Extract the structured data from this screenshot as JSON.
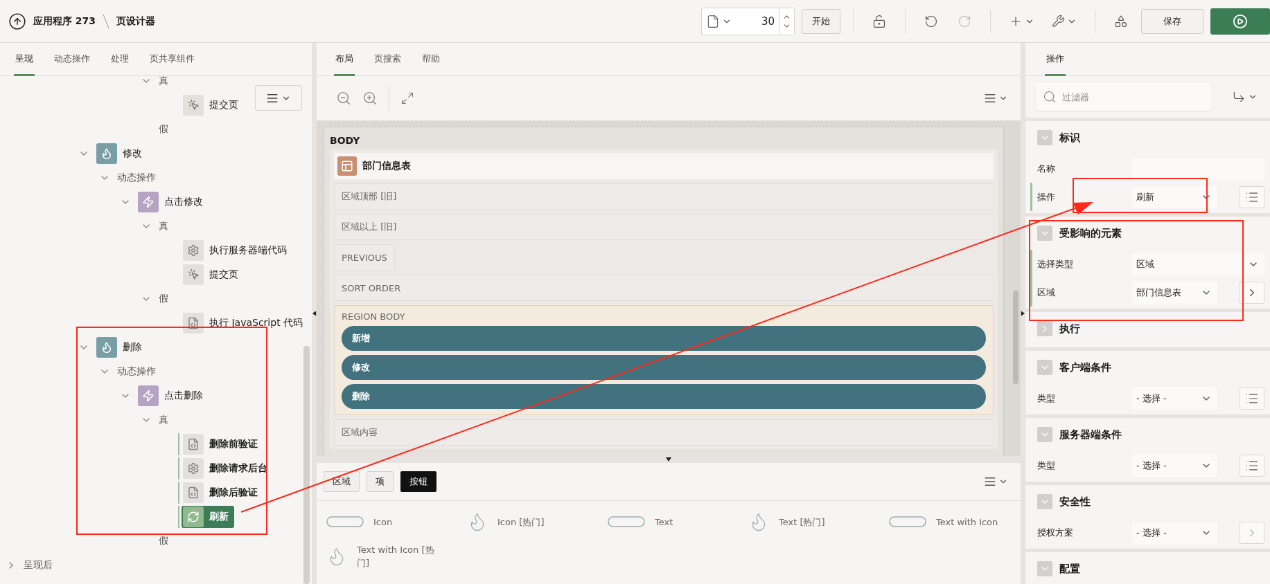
{
  "header": {
    "app": "应用程序 273",
    "page_title": "页设计器",
    "page_number": "30",
    "go_label": "开始",
    "redo": {
      "disabled": true
    },
    "save_label": "保存"
  },
  "left_tabs": [
    {
      "label": "呈现",
      "selected": true
    },
    {
      "label": "动态操作",
      "selected": false
    },
    {
      "label": "处理",
      "selected": false
    },
    {
      "label": "页共享组件",
      "selected": false
    }
  ],
  "tree": {
    "partial": [
      {
        "label": "真",
        "kind": "folder",
        "expanded": true,
        "selected": false,
        "children": [
          {
            "label": "提交页",
            "kind": "submit",
            "selected": false,
            "marked": false
          }
        ]
      },
      {
        "label": "假",
        "kind": "folder",
        "selected": false
      }
    ],
    "branches": [
      {
        "label": "修改",
        "kind": "button",
        "expanded": true,
        "selected": false,
        "children": [
          {
            "label": "动态操作",
            "kind": "folder",
            "expanded": true,
            "selected": false,
            "children": [
              {
                "label": "点击修改",
                "kind": "event",
                "expanded": true,
                "selected": false,
                "children": [
                  {
                    "label": "真",
                    "kind": "folder",
                    "expanded": true,
                    "selected": false,
                    "children": [
                      {
                        "label": "执行服务器端代码",
                        "kind": "server",
                        "selected": false,
                        "marked": false
                      },
                      {
                        "label": "提交页",
                        "kind": "submit",
                        "selected": false,
                        "marked": false
                      }
                    ]
                  },
                  {
                    "label": "假",
                    "kind": "folder",
                    "expanded": true,
                    "selected": false,
                    "children": [
                      {
                        "label": "执行 JavaScript 代码",
                        "kind": "js",
                        "selected": false,
                        "marked": false
                      }
                    ]
                  }
                ]
              }
            ]
          }
        ]
      },
      {
        "label": "删除",
        "kind": "button",
        "expanded": true,
        "selected": false,
        "children": [
          {
            "label": "动态操作",
            "kind": "folder",
            "expanded": true,
            "selected": false,
            "children": [
              {
                "label": "点击删除",
                "kind": "event",
                "expanded": true,
                "selected": false,
                "children": [
                  {
                    "label": "真",
                    "kind": "folder",
                    "expanded": true,
                    "selected": false,
                    "children": [
                      {
                        "label": "删除前验证",
                        "kind": "js",
                        "selected": false,
                        "marked": true
                      },
                      {
                        "label": "删除请求后台",
                        "kind": "server",
                        "selected": false,
                        "marked": true
                      },
                      {
                        "label": "删除后验证",
                        "kind": "js",
                        "selected": false,
                        "marked": true
                      },
                      {
                        "label": "刷新",
                        "kind": "refresh",
                        "selected": true,
                        "marked": true
                      }
                    ]
                  },
                  {
                    "label": "假",
                    "kind": "folder",
                    "selected": false
                  }
                ]
              }
            ]
          }
        ]
      }
    ],
    "after": [
      {
        "label": "呈现后",
        "kind": "folder",
        "expanded": false,
        "selected": false
      }
    ]
  },
  "center_tabs": [
    {
      "label": "布局",
      "selected": true
    },
    {
      "label": "页搜索",
      "selected": false
    },
    {
      "label": "帮助",
      "selected": false
    }
  ],
  "canvas": {
    "container": "BODY",
    "region": "部门信息表",
    "slots": [
      {
        "label": "区域顶部 [旧]",
        "kind": "slot"
      },
      {
        "label": "区域以上 [旧]",
        "kind": "slot"
      },
      {
        "label": "PREVIOUS",
        "kind": "compact"
      },
      {
        "label": "SORT ORDER",
        "kind": "slot"
      },
      {
        "label": "REGION BODY",
        "kind": "body",
        "buttons": [
          "新增",
          "修改",
          "删除"
        ]
      },
      {
        "label": "区域内容",
        "kind": "slot"
      }
    ]
  },
  "palette": {
    "tabs": [
      {
        "label": "区域",
        "selected": false
      },
      {
        "label": "项",
        "selected": false
      },
      {
        "label": "按钮",
        "selected": true
      }
    ],
    "items": [
      {
        "label": "Icon",
        "kind": "pill"
      },
      {
        "label": "Icon [热门]",
        "kind": "hot"
      },
      {
        "label": "Text",
        "kind": "pill"
      },
      {
        "label": "Text [热门]",
        "kind": "hot"
      },
      {
        "label": "Text with Icon",
        "kind": "pill"
      },
      {
        "label": "Text with Icon [热门]",
        "kind": "hot"
      }
    ]
  },
  "right_tabs": [
    {
      "label": "操作",
      "selected": true
    }
  ],
  "filter": {
    "placeholder": "过滤器"
  },
  "sections": [
    {
      "title": "标识",
      "expanded": true,
      "fields": [
        {
          "label": "名称",
          "kind": "text",
          "required": false
        },
        {
          "label": "操作",
          "kind": "select",
          "value": "刷新",
          "required": true,
          "trailing": {
            "kind": "list",
            "disabled": false
          }
        }
      ]
    },
    {
      "title": "受影响的元素",
      "expanded": true,
      "fields": [
        {
          "label": "选择类型",
          "kind": "select",
          "value": "区域",
          "required": true
        },
        {
          "label": "区域",
          "kind": "select",
          "value": "部门信息表",
          "required": true,
          "trailing": {
            "kind": "go",
            "disabled": false
          }
        }
      ]
    },
    {
      "title": "执行",
      "expanded": false
    },
    {
      "title": "客户端条件",
      "expanded": true,
      "fields": [
        {
          "label": "类型",
          "kind": "select",
          "value": "- 选择 -",
          "required": false,
          "trailing": {
            "kind": "list",
            "disabled": false
          }
        }
      ]
    },
    {
      "title": "服务器端条件",
      "expanded": true,
      "fields": [
        {
          "label": "类型",
          "kind": "select",
          "value": "- 选择 -",
          "required": false,
          "trailing": {
            "kind": "list",
            "disabled": false
          }
        }
      ]
    },
    {
      "title": "安全性",
      "expanded": true,
      "fields": [
        {
          "label": "授权方案",
          "kind": "select",
          "value": "- 选择 -",
          "required": false,
          "trailing": {
            "kind": "go",
            "disabled": true
          }
        }
      ]
    },
    {
      "title": "配置",
      "expanded": true
    }
  ]
}
